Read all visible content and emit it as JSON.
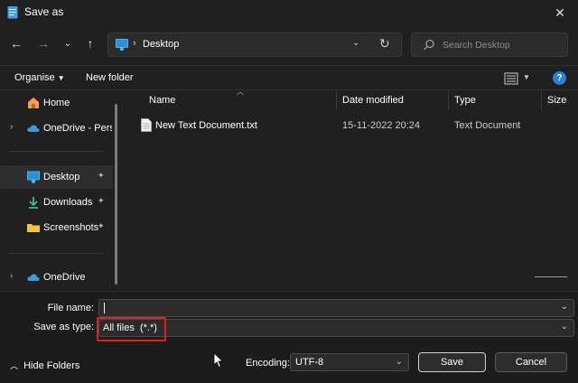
{
  "window": {
    "title": "Save as",
    "close_icon": "close-icon"
  },
  "nav": {
    "back_icon": "back-arrow-icon",
    "forward_icon": "forward-arrow-icon",
    "recent_icon": "chevron-down-icon",
    "up_icon": "up-arrow-icon",
    "address": "Desktop",
    "search_placeholder": "Search Desktop"
  },
  "toolbar": {
    "organise": "Organise",
    "new_folder": "New folder"
  },
  "sidebar": {
    "items": [
      {
        "label": "Home",
        "icon": "home-icon"
      },
      {
        "label": "OneDrive - Perso",
        "icon": "cloud-icon"
      },
      {
        "label": "Desktop",
        "icon": "desktop-icon"
      },
      {
        "label": "Downloads",
        "icon": "download-icon"
      },
      {
        "label": "Screenshots",
        "icon": "folder-icon"
      },
      {
        "label": "OneDrive",
        "icon": "cloud-icon"
      }
    ]
  },
  "file_list": {
    "columns": [
      "Name",
      "Date modified",
      "Type",
      "Size"
    ],
    "rows": [
      {
        "name": "New Text Document.txt",
        "date": "15-11-2022 20:24",
        "type": "Text Document"
      }
    ]
  },
  "form": {
    "file_name_label": "File name:",
    "file_name_value": "",
    "save_as_type_label": "Save as type:",
    "save_as_type_value": "All files  (*.*)",
    "encoding_label": "Encoding:",
    "encoding_value": "UTF-8"
  },
  "actions": {
    "hide_folders": "Hide Folders",
    "save": "Save",
    "cancel": "Cancel"
  },
  "colors": {
    "highlight_box": "#e02020",
    "accent": "#2a7fd4"
  }
}
